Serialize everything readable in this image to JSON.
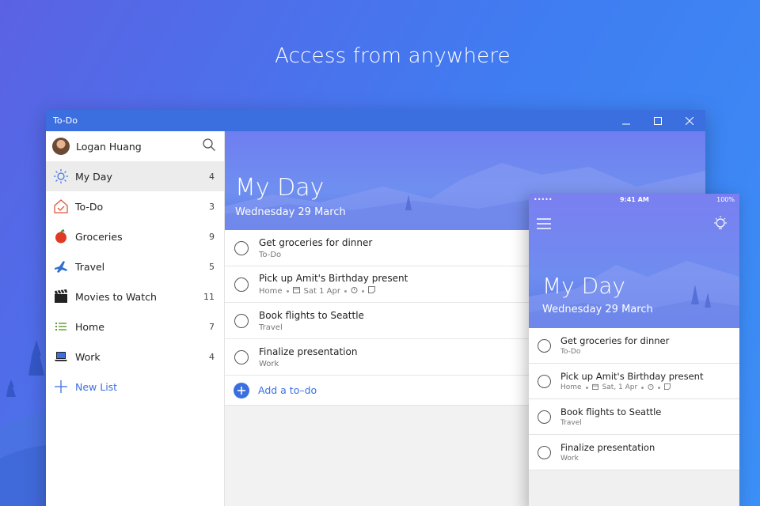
{
  "headline": "Access from anywhere",
  "window": {
    "title": "To-Do",
    "controls": [
      "minimize-icon",
      "maximize-icon",
      "close-icon"
    ]
  },
  "sidebar": {
    "user": {
      "name": "Logan Huang"
    },
    "items": [
      {
        "label": "My Day",
        "count": "4",
        "icon": "sun-icon",
        "active": true
      },
      {
        "label": "To-Do",
        "count": "3",
        "icon": "home-icon"
      },
      {
        "label": "Groceries",
        "count": "9",
        "icon": "apple-icon"
      },
      {
        "label": "Travel",
        "count": "5",
        "icon": "airplane-icon"
      },
      {
        "label": "Movies to Watch",
        "count": "11",
        "icon": "clapperboard-icon"
      },
      {
        "label": "Home",
        "count": "7",
        "icon": "list-icon"
      },
      {
        "label": "Work",
        "count": "4",
        "icon": "laptop-icon"
      }
    ],
    "new_list": "New List"
  },
  "main": {
    "title": "My Day",
    "date": "Wednesday 29 March",
    "tasks": [
      {
        "title": "Get groceries for dinner",
        "list": "To-Do"
      },
      {
        "title": "Pick up Amit's Birthday present",
        "list": "Home",
        "due": "Sat 1 Apr"
      },
      {
        "title": "Book flights to Seattle",
        "list": "Travel"
      },
      {
        "title": "Finalize presentation",
        "list": "Work"
      }
    ],
    "add_placeholder": "Add a to–do"
  },
  "phone": {
    "status": {
      "signal": "•••••",
      "time": "9:41 AM",
      "battery": "100%"
    },
    "title": "My Day",
    "date": "Wednesday 29 March",
    "tasks": [
      {
        "title": "Get groceries for dinner",
        "list": "To-Do"
      },
      {
        "title": "Pick up Amit's Birthday present",
        "list": "Home",
        "due": "Sat, 1 Apr"
      },
      {
        "title": "Book flights to Seattle",
        "list": "Travel"
      },
      {
        "title": "Finalize presentation",
        "list": "Work"
      }
    ]
  },
  "colors": {
    "accent": "#3b6fe0",
    "background": "#4f72ec"
  }
}
